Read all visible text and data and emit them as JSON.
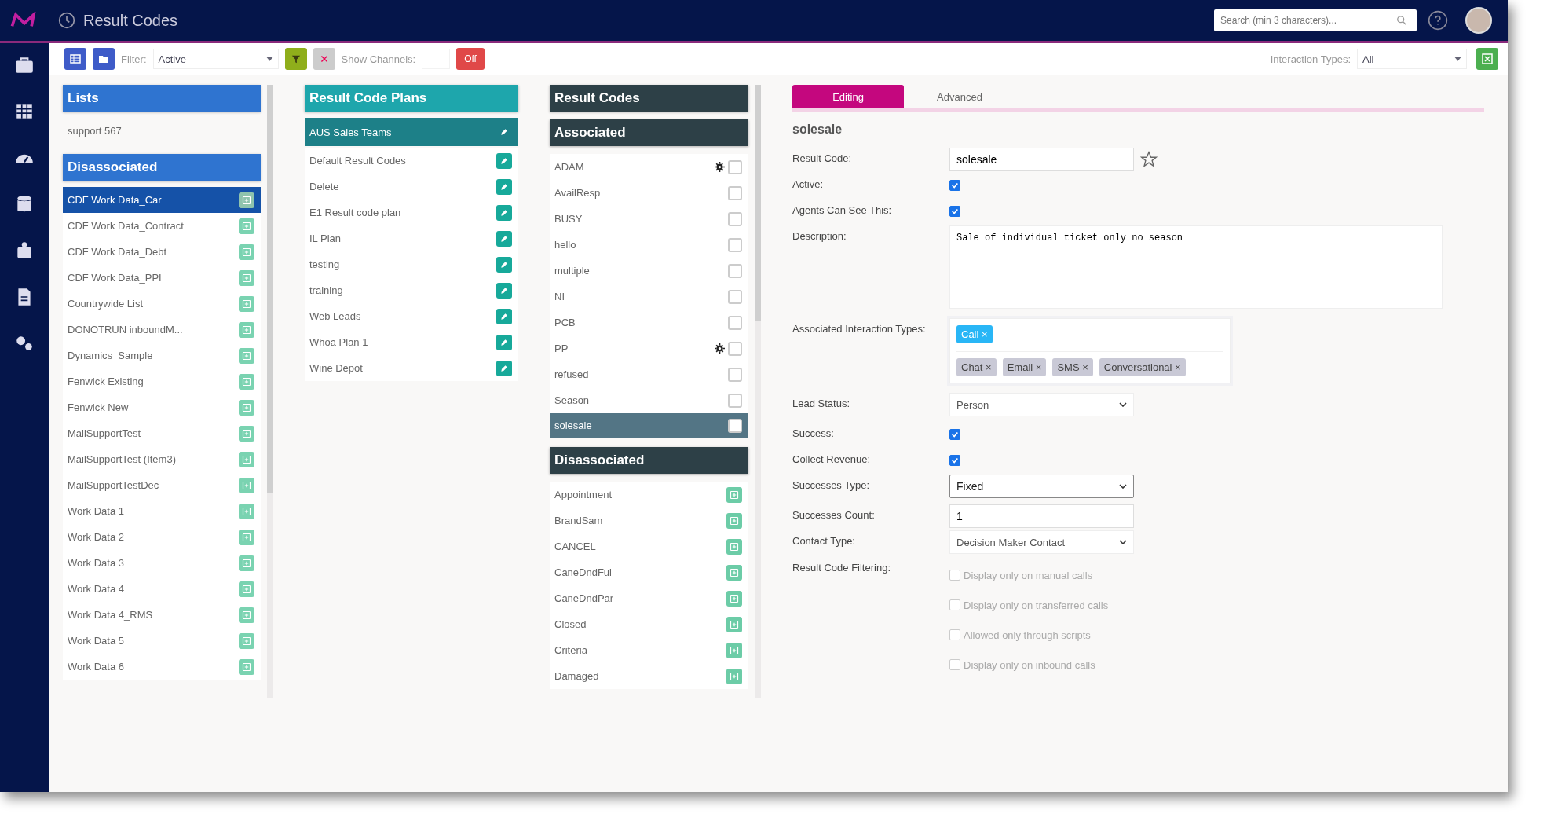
{
  "topbar": {
    "title": "Result Codes",
    "search": {
      "placeholder": "Search (min 3 characters)..."
    }
  },
  "toolbar": {
    "filter_label": "Filter:",
    "filter_value": "Active",
    "show_channels_label": "Show Channels:",
    "channels_toggle": "Off",
    "interaction_types_label": "Interaction Types:",
    "interaction_types_value": "All"
  },
  "lists": {
    "title": "Lists",
    "associated": [
      {
        "label": "support 567",
        "selected": false
      }
    ],
    "disassociated_title": "Disassociated",
    "disassociated": [
      {
        "label": "CDF Work Data_Car",
        "selected": true
      },
      {
        "label": "CDF Work Data_Contract",
        "selected": false
      },
      {
        "label": "CDF Work Data_Debt",
        "selected": false
      },
      {
        "label": "CDF Work Data_PPI",
        "selected": false
      },
      {
        "label": "Countrywide List",
        "selected": false
      },
      {
        "label": "DONOTRUN inboundM...",
        "selected": false
      },
      {
        "label": "Dynamics_Sample",
        "selected": false
      },
      {
        "label": "Fenwick Existing",
        "selected": false
      },
      {
        "label": "Fenwick New",
        "selected": false
      },
      {
        "label": "MailSupportTest",
        "selected": false
      },
      {
        "label": "MailSupportTest (Item3)",
        "selected": false
      },
      {
        "label": "MailSupportTestDec",
        "selected": false
      },
      {
        "label": "Work Data 1",
        "selected": false
      },
      {
        "label": "Work Data 2",
        "selected": false
      },
      {
        "label": "Work Data 3",
        "selected": false
      },
      {
        "label": "Work Data 4",
        "selected": false
      },
      {
        "label": "Work Data 4_RMS",
        "selected": false
      },
      {
        "label": "Work Data 5",
        "selected": false
      },
      {
        "label": "Work Data 6",
        "selected": false
      }
    ]
  },
  "plans": {
    "title": "Result Code Plans",
    "items": [
      {
        "label": "AUS Sales Teams",
        "selected": true
      },
      {
        "label": "Default Result Codes",
        "selected": false
      },
      {
        "label": "Delete",
        "selected": false
      },
      {
        "label": "E1 Result code plan",
        "selected": false
      },
      {
        "label": "IL Plan",
        "selected": false
      },
      {
        "label": "testing",
        "selected": false
      },
      {
        "label": "training",
        "selected": false
      },
      {
        "label": "Web Leads",
        "selected": false
      },
      {
        "label": "Whoa Plan 1",
        "selected": false
      },
      {
        "label": "Wine Depot",
        "selected": false
      }
    ]
  },
  "result_codes": {
    "title": "Result Codes",
    "associated_title": "Associated",
    "associated": [
      {
        "label": "ADAM",
        "selected": false,
        "default": true
      },
      {
        "label": "AvailResp",
        "selected": false,
        "default": false
      },
      {
        "label": "BUSY",
        "selected": false,
        "default": false
      },
      {
        "label": "hello",
        "selected": false,
        "default": false
      },
      {
        "label": "multiple",
        "selected": false,
        "default": false
      },
      {
        "label": "NI",
        "selected": false,
        "default": false
      },
      {
        "label": "PCB",
        "selected": false,
        "default": false
      },
      {
        "label": "PP",
        "selected": false,
        "default": true
      },
      {
        "label": "refused",
        "selected": false,
        "default": false
      },
      {
        "label": "Season",
        "selected": false,
        "default": false
      },
      {
        "label": "solesale",
        "selected": true,
        "default": false
      }
    ],
    "disassociated_title": "Disassociated",
    "disassociated": [
      {
        "label": "Appointment",
        "selected": false
      },
      {
        "label": "BrandSam",
        "selected": false
      },
      {
        "label": "CANCEL",
        "selected": false
      },
      {
        "label": "CaneDndFul",
        "selected": false
      },
      {
        "label": "CaneDndPar",
        "selected": false
      },
      {
        "label": "Closed",
        "selected": false
      },
      {
        "label": "Criteria",
        "selected": false
      },
      {
        "label": "Damaged",
        "selected": false
      }
    ]
  },
  "editor": {
    "tabs": [
      {
        "label": "Editing",
        "selected": true
      },
      {
        "label": "Advanced",
        "selected": false
      }
    ],
    "heading": "solesale",
    "fields": [
      {
        "kind": "text",
        "label": "Result Code:",
        "value": "solesale",
        "favorite": false
      },
      {
        "kind": "checkbox",
        "label": "Active:",
        "checked": true
      },
      {
        "kind": "checkbox",
        "label": "Agents Can See This:",
        "checked": true
      },
      {
        "kind": "textarea",
        "label": "Description:",
        "value": "Sale of individual ticket only no season"
      },
      {
        "kind": "tags",
        "label": "Associated Interaction Types:",
        "remove_glyph": "×",
        "tags": [
          {
            "label": "Call",
            "selected": true
          },
          {
            "label": "Chat",
            "selected": false
          },
          {
            "label": "Email",
            "selected": false
          },
          {
            "label": "SMS",
            "selected": false
          },
          {
            "label": "Conversational",
            "selected": false
          }
        ]
      },
      {
        "kind": "select",
        "label": "Lead Status:",
        "value": "Person"
      },
      {
        "kind": "checkbox",
        "label": "Success:",
        "checked": true
      },
      {
        "kind": "checkbox",
        "label": "Collect Revenue:",
        "checked": true
      },
      {
        "kind": "dropdown",
        "label": "Successes Type:",
        "value": "Fixed"
      },
      {
        "kind": "text",
        "label": "Successes Count:",
        "value": "1"
      },
      {
        "kind": "select",
        "label": "Contact Type:",
        "value": "Decision Maker Contact"
      },
      {
        "kind": "options",
        "label": "Result Code Filtering:",
        "options": [
          {
            "label": "Display only on manual calls",
            "checked": false
          },
          {
            "label": "Display only on transferred calls",
            "checked": false
          },
          {
            "label": "Allowed only through scripts",
            "checked": false
          },
          {
            "label": "Display only on inbound calls",
            "checked": false
          }
        ]
      }
    ]
  }
}
